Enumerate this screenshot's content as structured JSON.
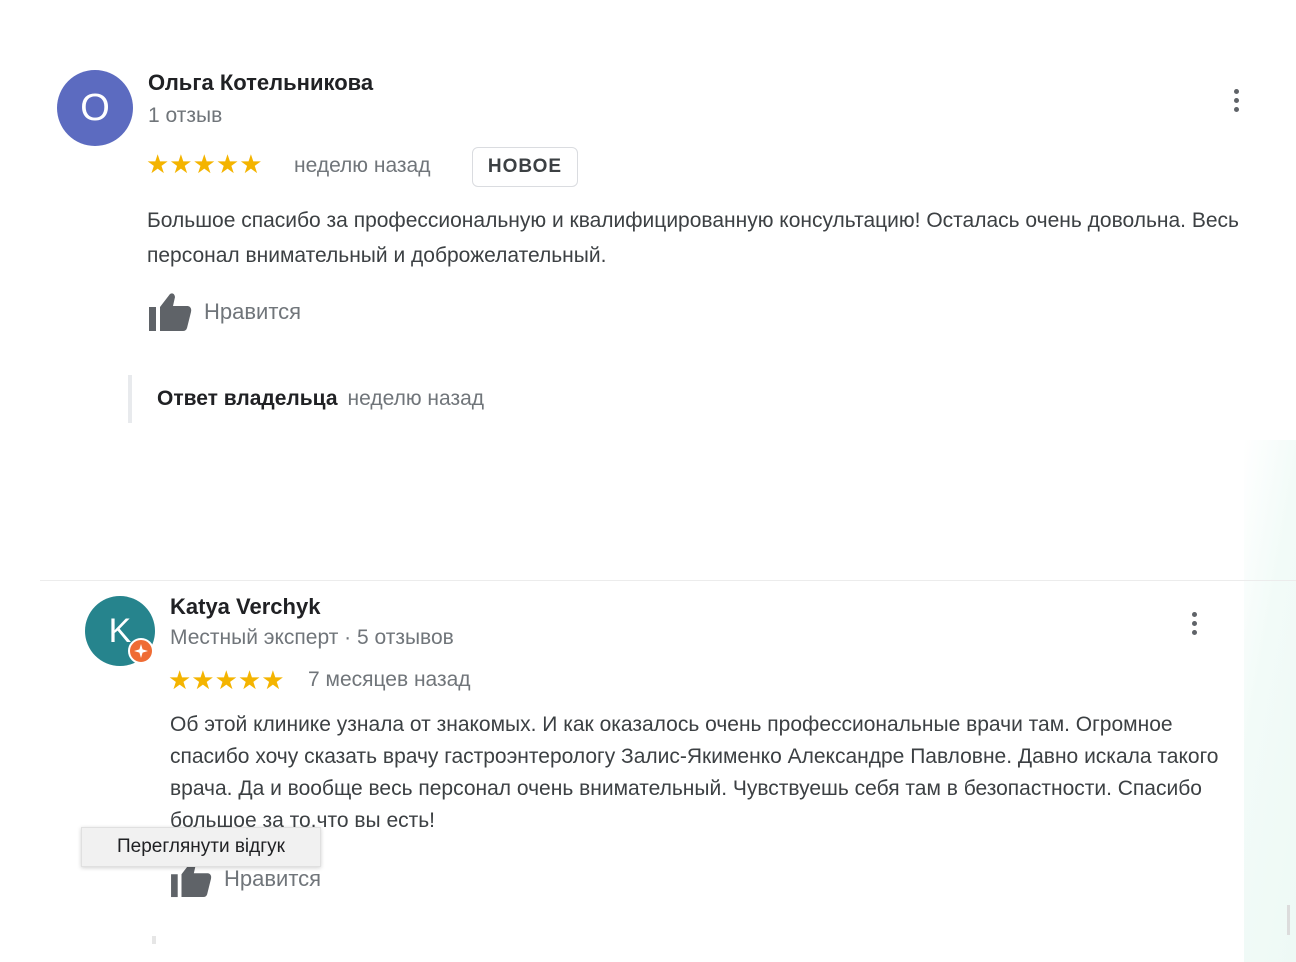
{
  "reviews": [
    {
      "avatar_letter": "О",
      "avatar_color": "#5c6bc0",
      "name": "Ольга Котельникова",
      "meta": "1 отзыв",
      "stars": "★★★★★",
      "rating": 5,
      "date": "неделю назад",
      "badge": "НОВОЕ",
      "text": "Большое спасибо за профессиональную и квалифицированную консультацию! Осталась очень довольна. Весь персонал внимательный и доброжелательный.",
      "like_label": "Нравится",
      "owner_reply": {
        "label": "Ответ владельца",
        "date": "неделю назад"
      }
    },
    {
      "avatar_letter": "K",
      "avatar_color": "#26848d",
      "name": "Katya Verchyk",
      "meta": "Местный эксперт · 5 отзывов",
      "stars": "★★★★★",
      "rating": 5,
      "date": "7 месяцев назад",
      "text": "Об этой клинике узнала от знакомых. И как оказалось очень профессиональные врачи там. Огромное спасибо хочу сказать врачу гастроэнтерологу Залис-Якименко Александре Павловне. Давно искала такого врача. Да и вообще весь персонал очень внимательный. Чувствуешь себя там в безопастности. Спасибо большое за то,что вы есть!",
      "like_label": "Нравится"
    }
  ],
  "tooltip": "Переглянути відгук",
  "colors": {
    "star": "#f4b400",
    "expert_badge": "#ef6c34",
    "muted_text": "#70757a"
  }
}
